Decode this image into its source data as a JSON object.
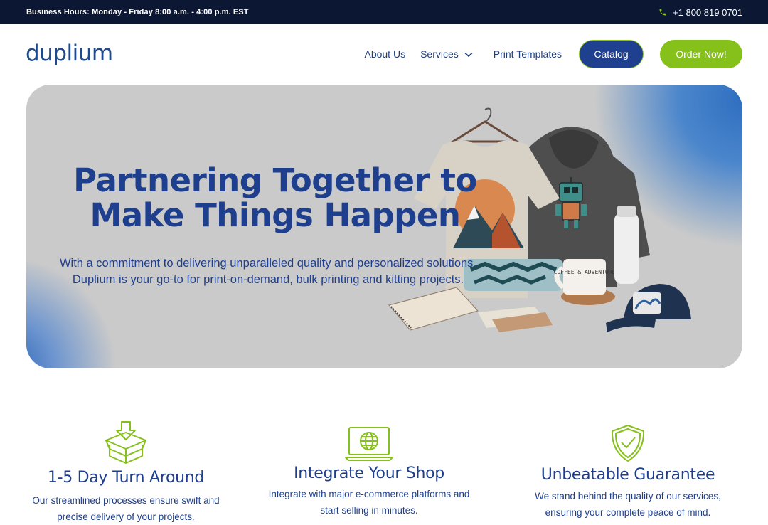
{
  "topbar": {
    "hours": "Business Hours: Monday - Friday 8:00 a.m. - 4:00 p.m. EST",
    "phone": "+1 800 819 0701",
    "phone_icon": "phone-icon"
  },
  "header": {
    "logo": "duplium",
    "nav": {
      "about": "About Us",
      "services": "Services",
      "templates": "Print Templates"
    },
    "catalog_label": "Catalog",
    "order_label": "Order Now!"
  },
  "hero": {
    "title_line1": "Partnering Together to",
    "title_line2": "Make Things Happen",
    "text_line1": "With a commitment to delivering unparalleled quality and personalized solutions,",
    "text_line2": "Duplium is your go-to for print-on-demand, bulk printing and kitting projects.",
    "mug_text": "COFFEE & ADVENTURE",
    "bottle_text": "COFFEE & ADVENTURE"
  },
  "features": [
    {
      "icon": "box-icon",
      "title": "1-5 Day Turn Around",
      "desc_line1": "Our streamlined processes ensure swift and",
      "desc_line2": "precise delivery of your projects."
    },
    {
      "icon": "globe-laptop-icon",
      "title": "Integrate Your Shop",
      "desc_line1": "Integrate with major e-commerce platforms and",
      "desc_line2": "start selling in minutes."
    },
    {
      "icon": "shield-check-icon",
      "title": "Unbeatable Guarantee",
      "desc_line1": "We stand behind the quality of our services,",
      "desc_line2": "ensuring your complete peace of mind."
    }
  ],
  "colors": {
    "navy": "#0b1733",
    "brand_blue": "#1f3f8f",
    "lime": "#86c01a"
  }
}
